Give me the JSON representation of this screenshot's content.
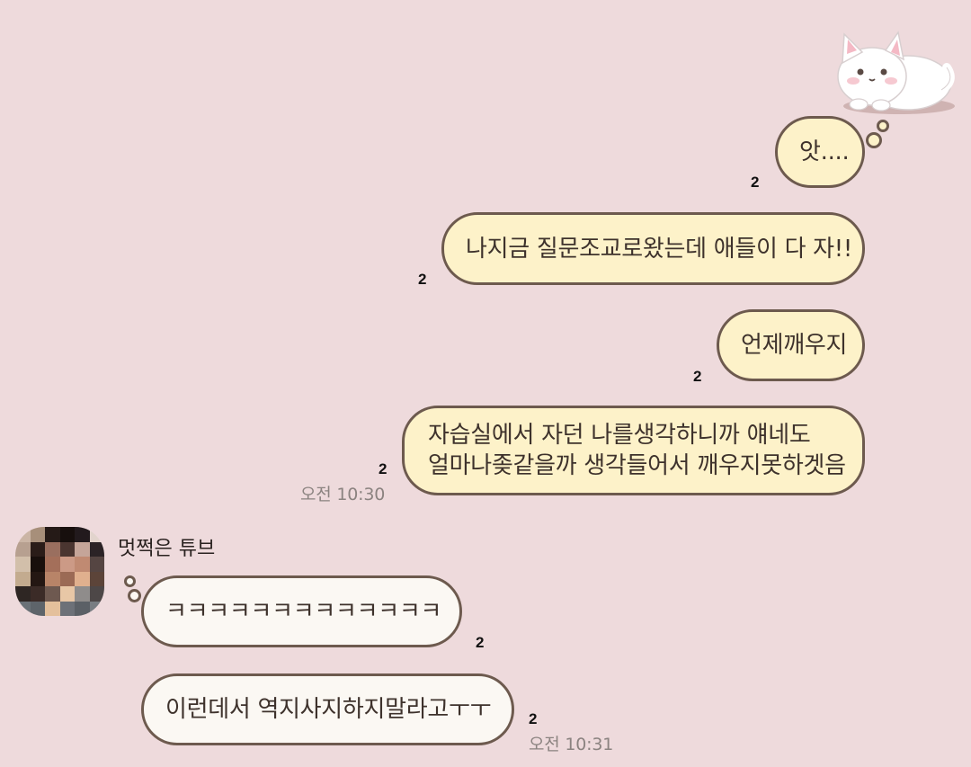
{
  "sticker": {
    "icon": "white-cat-sticker"
  },
  "messages_mine": [
    {
      "text": "앗....",
      "unread": "2"
    },
    {
      "text": "나지금 질문조교로왔는데 애들이 다 자!!",
      "unread": "2"
    },
    {
      "text": "언제깨우지",
      "unread": "2"
    },
    {
      "line1": "자습실에서 자던 나를생각하니까 얘네도",
      "line2": "얼마나좆같을까 생각들어서 깨우지못하겟음",
      "unread": "2",
      "time": "오전 10:30"
    }
  ],
  "other_user": {
    "name": "멋쩍은 튜브",
    "avatar_icon": "pixelated-avatar"
  },
  "messages_theirs": [
    {
      "text": "ㅋㅋㅋㅋㅋㅋㅋㅋㅋㅋㅋㅋㅋ",
      "unread": "2"
    },
    {
      "text": "이런데서 역지사지하지말라고ㅜㅜ",
      "unread": "2",
      "time": "오전 10:31"
    }
  ],
  "colors": {
    "background": "#eedadc",
    "my_bubble": "#fdf2c9",
    "their_bubble": "#fbf8f3",
    "bubble_border": "#6d5a4e"
  }
}
